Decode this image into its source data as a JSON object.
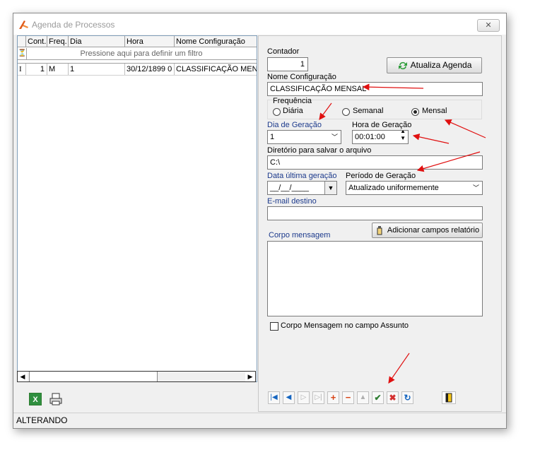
{
  "window": {
    "title": "Agenda de Processos",
    "close_label": "✕"
  },
  "grid": {
    "columns": [
      "Cont.",
      "Freq.",
      "Dia",
      "Hora",
      "Nome Configuração"
    ],
    "filter_placeholder": "Pressione aqui para definir um filtro",
    "rows": [
      {
        "indicator": "I",
        "cont": "1",
        "freq": "M",
        "dia": "1",
        "hora": "30/12/1899 0",
        "nome": "CLASSIFICAÇÃO MENSAL"
      }
    ]
  },
  "form": {
    "contador_label": "Contador",
    "contador_value": "1",
    "atualiza_button": "Atualiza Agenda",
    "nome_label": "Nome Configuração",
    "nome_value": "CLASSIFICAÇÃO MENSAL",
    "frequencia_label": "Frequência",
    "freq_options": [
      "Diária",
      "Semanal",
      "Mensal"
    ],
    "freq_selected": "Mensal",
    "dia_label": "Dia de Geração",
    "dia_value": "1",
    "hora_label": "Hora de Geração",
    "hora_value": "00:01:00",
    "diretorio_label": "Diretório para salvar o arquivo",
    "diretorio_value": "C:\\",
    "data_label": "Data última geração",
    "data_value": "__/__/____",
    "periodo_label": "Período de Geração",
    "periodo_value": "Atualizado uniformemente",
    "email_label": "E-mail destino",
    "email_value": "",
    "adicionar_button": "Adicionar campos relatório",
    "corpo_label": "Corpo mensagem",
    "corpo_value": "",
    "checkbox_label": "Corpo Mensagem no campo Assunto"
  },
  "status": {
    "text": "ALTERANDO"
  },
  "colors": {
    "accent_blue": "#1c3a8c",
    "arrow_red": "#e01010"
  },
  "icons": [
    "app-icon",
    "refresh-icon",
    "wizard-icon",
    "excel-icon",
    "print-icon",
    "exit-door-icon"
  ]
}
